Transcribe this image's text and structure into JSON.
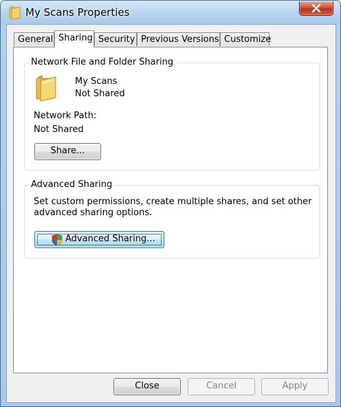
{
  "window": {
    "title": "My Scans Properties",
    "title_icon": "folder-icon"
  },
  "tabs": [
    {
      "label": "General",
      "active": false
    },
    {
      "label": "Sharing",
      "active": true
    },
    {
      "label": "Security",
      "active": false
    },
    {
      "label": "Previous Versions",
      "active": false
    },
    {
      "label": "Customize",
      "active": false
    }
  ],
  "network_sharing": {
    "group_label": "Network File and Folder Sharing",
    "folder_name": "My Scans",
    "share_status": "Not Shared",
    "path_label": "Network Path:",
    "path_value": "Not Shared",
    "share_button": "Share..."
  },
  "advanced_sharing": {
    "group_label": "Advanced Sharing",
    "description_line1": "Set custom permissions, create multiple shares, and set other",
    "description_line2": "advanced sharing options.",
    "button_label": "Advanced Sharing...",
    "button_icon": "uac-shield-icon"
  },
  "footer": {
    "close": "Close",
    "cancel": "Cancel",
    "apply": "Apply"
  },
  "colors": {
    "title_gradient": "#bcd6f0",
    "close_button": "#c8452c",
    "dialog_bg": "#f0f0f0",
    "focus_border": "#3c7fb1"
  }
}
